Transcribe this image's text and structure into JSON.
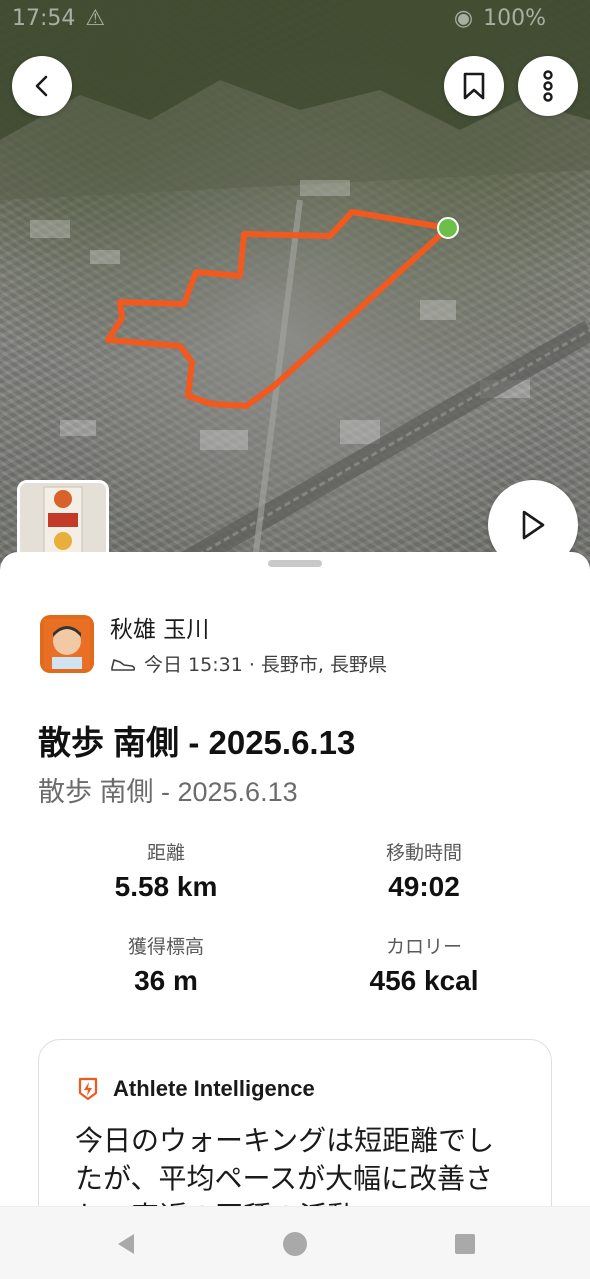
{
  "status_bar": {
    "time": "17:54",
    "battery": "100%"
  },
  "map": {
    "route_color": "#f2591f",
    "start_marker_color": "#6cc04a",
    "back_icon": "chevron-left-icon",
    "bookmark_icon": "bookmark-icon",
    "more_icon": "more-vertical-icon",
    "play_icon": "play-icon"
  },
  "athlete": {
    "name": "秋雄 玉川",
    "activity_icon": "shoe-icon",
    "meta": "今日 15:31 · 長野市, 長野県"
  },
  "activity": {
    "title": "散歩 南側 - 2025.6.13",
    "description": "散歩 南側 - 2025.6.13"
  },
  "stats": [
    {
      "label": "距離",
      "value": "5.58 km"
    },
    {
      "label": "移動時間",
      "value": "49:02"
    },
    {
      "label": "獲得標高",
      "value": "36 m"
    },
    {
      "label": "カロリー",
      "value": "456 kcal"
    }
  ],
  "ai_card": {
    "icon": "athlete-intelligence-icon",
    "accent_color": "#f2591f",
    "title": "Athlete Intelligence",
    "body": "今日のウォーキングは短距離でしたが、平均ペースが大幅に改善され、直近の同種の活動"
  },
  "nav_bar": {
    "back_icon": "nav-back-icon",
    "home_icon": "nav-home-icon",
    "recent_icon": "nav-recent-icon"
  }
}
